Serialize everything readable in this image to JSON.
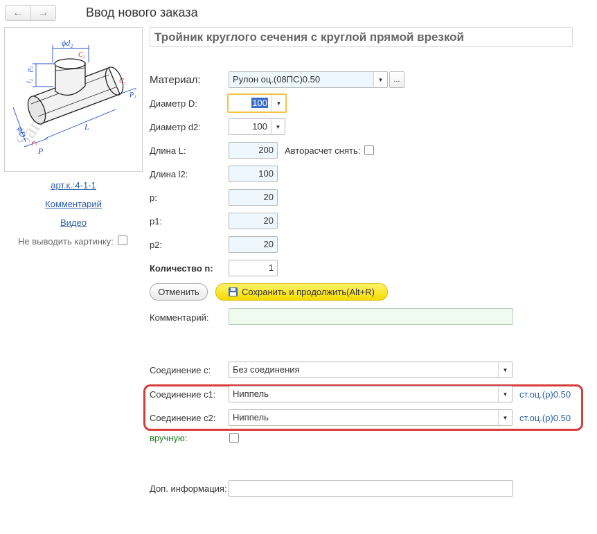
{
  "header": {
    "back_icon": "arrow-left-icon",
    "forward_icon": "arrow-right-icon",
    "title": "Ввод нового заказа"
  },
  "sidebar": {
    "article_link": "арт.к.:4-1-1",
    "comment_link": "Комментарий",
    "video_link": "Видео",
    "hide_picture_label": "Не выводить картинку:",
    "hide_picture_checked": false,
    "drawing_labels": {
      "d2": "ϕd₂",
      "c2": "C₂",
      "l2": "l₂",
      "p2": "p₂",
      "c1": "C₁",
      "p1": "P₁",
      "D": "ϕD",
      "c": "C",
      "p": "P",
      "L": "L",
      "watermark": "Sandvent.ru"
    }
  },
  "product": {
    "title": "Тройник круглого сечения с круглой прямой врезкой"
  },
  "form": {
    "material": {
      "label": "Материал:",
      "value": "Рулон оц.(08ПС)0.50",
      "more_button": "..."
    },
    "diameter_D": {
      "label": "Диаметр D:",
      "value": "100"
    },
    "diameter_d2": {
      "label": "Диаметр d2:",
      "value": "100"
    },
    "length_L": {
      "label": "Длина L:",
      "value": "200"
    },
    "auto_calc": {
      "label": "Авторасчет снять:",
      "checked": false
    },
    "length_l2": {
      "label": "Длина l2:",
      "value": "100"
    },
    "p": {
      "label": "p:",
      "value": "20"
    },
    "p1": {
      "label": "p1:",
      "value": "20"
    },
    "p2": {
      "label": "p2:",
      "value": "20"
    },
    "quantity": {
      "label": "Количество n:",
      "value": "1"
    },
    "cancel_button": "Отменить",
    "save_button": "Сохранить и продолжить(Alt+R)",
    "comment": {
      "label": "Комментарий:",
      "value": ""
    },
    "connection_c": {
      "label": "Соединение с:",
      "value": "Без соединения"
    },
    "connection_c1": {
      "label": "Соединение с1:",
      "value": "Ниппель",
      "material_link": "ст.оц.(р)0.50"
    },
    "connection_c2": {
      "label": "Соединение с2:",
      "value": "Ниппель",
      "material_link": "ст.оц.(р)0.50"
    },
    "manual": {
      "label": "вручную:",
      "checked": false
    },
    "extra_info": {
      "label": "Доп. информация:",
      "value": ""
    }
  },
  "colors": {
    "highlight_frame": "#d93a3a",
    "link": "#2a5ea8",
    "save_button": "#f5da00",
    "focus": "#f5c242"
  }
}
